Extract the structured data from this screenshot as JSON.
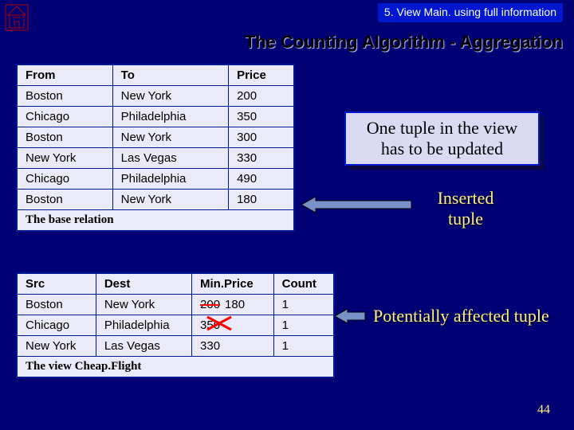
{
  "header_tab": "5. View Main. using full information",
  "title": "The Counting Algorithm - Aggregation",
  "base": {
    "cols": [
      "From",
      "To",
      "Price"
    ],
    "rows": [
      [
        "Boston",
        "New York",
        "200"
      ],
      [
        "Chicago",
        "Philadelphia",
        "350"
      ],
      [
        "Boston",
        "New York",
        "300"
      ],
      [
        "New York",
        "Las Vegas",
        "330"
      ],
      [
        "Chicago",
        "Philadelphia",
        "490"
      ],
      [
        "Boston",
        "New York",
        "180"
      ]
    ],
    "caption": "The base relation"
  },
  "view": {
    "cols": [
      "Src",
      "Dest",
      "Min.Price",
      "Count"
    ],
    "rows": [
      {
        "src": "Boston",
        "dest": "New York",
        "old_price": "200",
        "new_price": "180",
        "count": "1"
      },
      {
        "src": "Chicago",
        "dest": "Philadelphia",
        "old_price": null,
        "new_price": "350",
        "count": "1"
      },
      {
        "src": "New York",
        "dest": "Las Vegas",
        "old_price": null,
        "new_price": "330",
        "count": "1"
      }
    ],
    "caption": "The view Cheap.Flight"
  },
  "callout": "One tuple in the view has to be updated",
  "note_inserted": "Inserted tuple",
  "note_affected": "Potentially affected tuple",
  "slide_number": "44"
}
